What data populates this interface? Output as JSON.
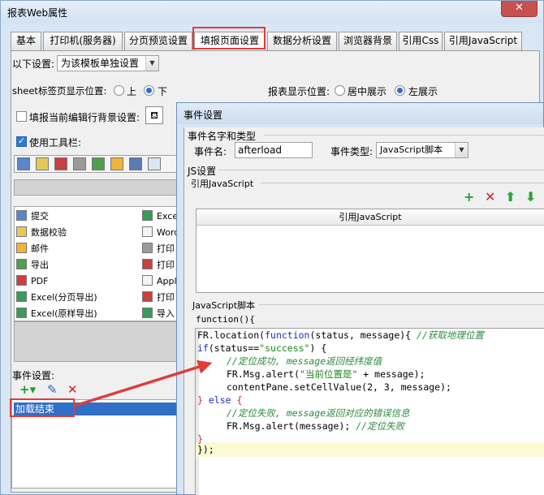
{
  "window": {
    "title": "报表Web属性",
    "close": "✕"
  },
  "tabs": [
    "基本",
    "打印机(服务器)",
    "分页预览设置",
    "填报页面设置",
    "数据分析设置",
    "浏览器背景",
    "引用Css",
    "引用JavaScript"
  ],
  "settings": {
    "following_label": "以下设置:",
    "following_value": "为该模板单独设置",
    "sheet_tab_label": "sheet标签页显示位置:",
    "sheet_tab_top": "上",
    "sheet_tab_bottom": "下",
    "report_pos_label": "报表显示位置:",
    "report_pos_center": "居中展示",
    "report_pos_left": "左展示",
    "row_bg_label": "填报当前编辑行背景设置:",
    "use_toolbar_label": "使用工具栏:"
  },
  "button_list": {
    "left": [
      "提交",
      "数据校验",
      "邮件",
      "导出",
      "PDF",
      "Excel(分页导出)",
      "Excel(原样导出)"
    ],
    "right": [
      "Exce",
      "Word",
      "打印",
      "打印",
      "Appl",
      "打印",
      "导入"
    ]
  },
  "events": {
    "label": "事件设置:",
    "add_icon": "+▾",
    "edit_icon": "✎",
    "delete_icon": "✕",
    "selected_event": "加载结束"
  },
  "dialog": {
    "title": "事件设置",
    "group_name_type": "事件名字和类型",
    "event_name_label": "事件名:",
    "event_name_value": "afterload",
    "event_type_label": "事件类型:",
    "event_type_value": "JavaScript脚本",
    "js_settings_label": "JS设置",
    "ref_js_label": "引用JavaScript",
    "ref_js_column": "引用JavaScript",
    "ref_add_icon": "+",
    "ref_delete_icon": "✕",
    "ref_up_icon": "⬆",
    "ref_down_icon": "⬇",
    "script_group_label": "JavaScript脚本",
    "function_header": "function(){",
    "code": {
      "l1_a": "FR.location(",
      "l1_kw": "function",
      "l1_b": "(status, message){ ",
      "l1_cm": "//获取地理位置",
      "l2_kw": "if",
      "l2_a": "(status==",
      "l2_str": "\"success\"",
      "l2_b": ") {",
      "l3_cm": "//定位成功, message返回经纬度值",
      "l4_a": "FR.Msg.alert(",
      "l4_str": "\"当前位置是\"",
      "l4_b": " + message);",
      "l5": "contentPane.setCellValue(2, 3, message);",
      "l6_a": "} ",
      "l6_kw": "else",
      "l6_b": " {",
      "l7_cm": "//定位失败, message返回对应的错误信息",
      "l8_a": "FR.Msg.alert(message); ",
      "l8_cm": "//定位失败",
      "l9": "}",
      "l10": "});"
    }
  },
  "colors": {
    "highlight": "#e03c3c",
    "selection": "#2f6fc5",
    "keyword": "#1c2dbd",
    "comment": "#2b8a3e"
  }
}
